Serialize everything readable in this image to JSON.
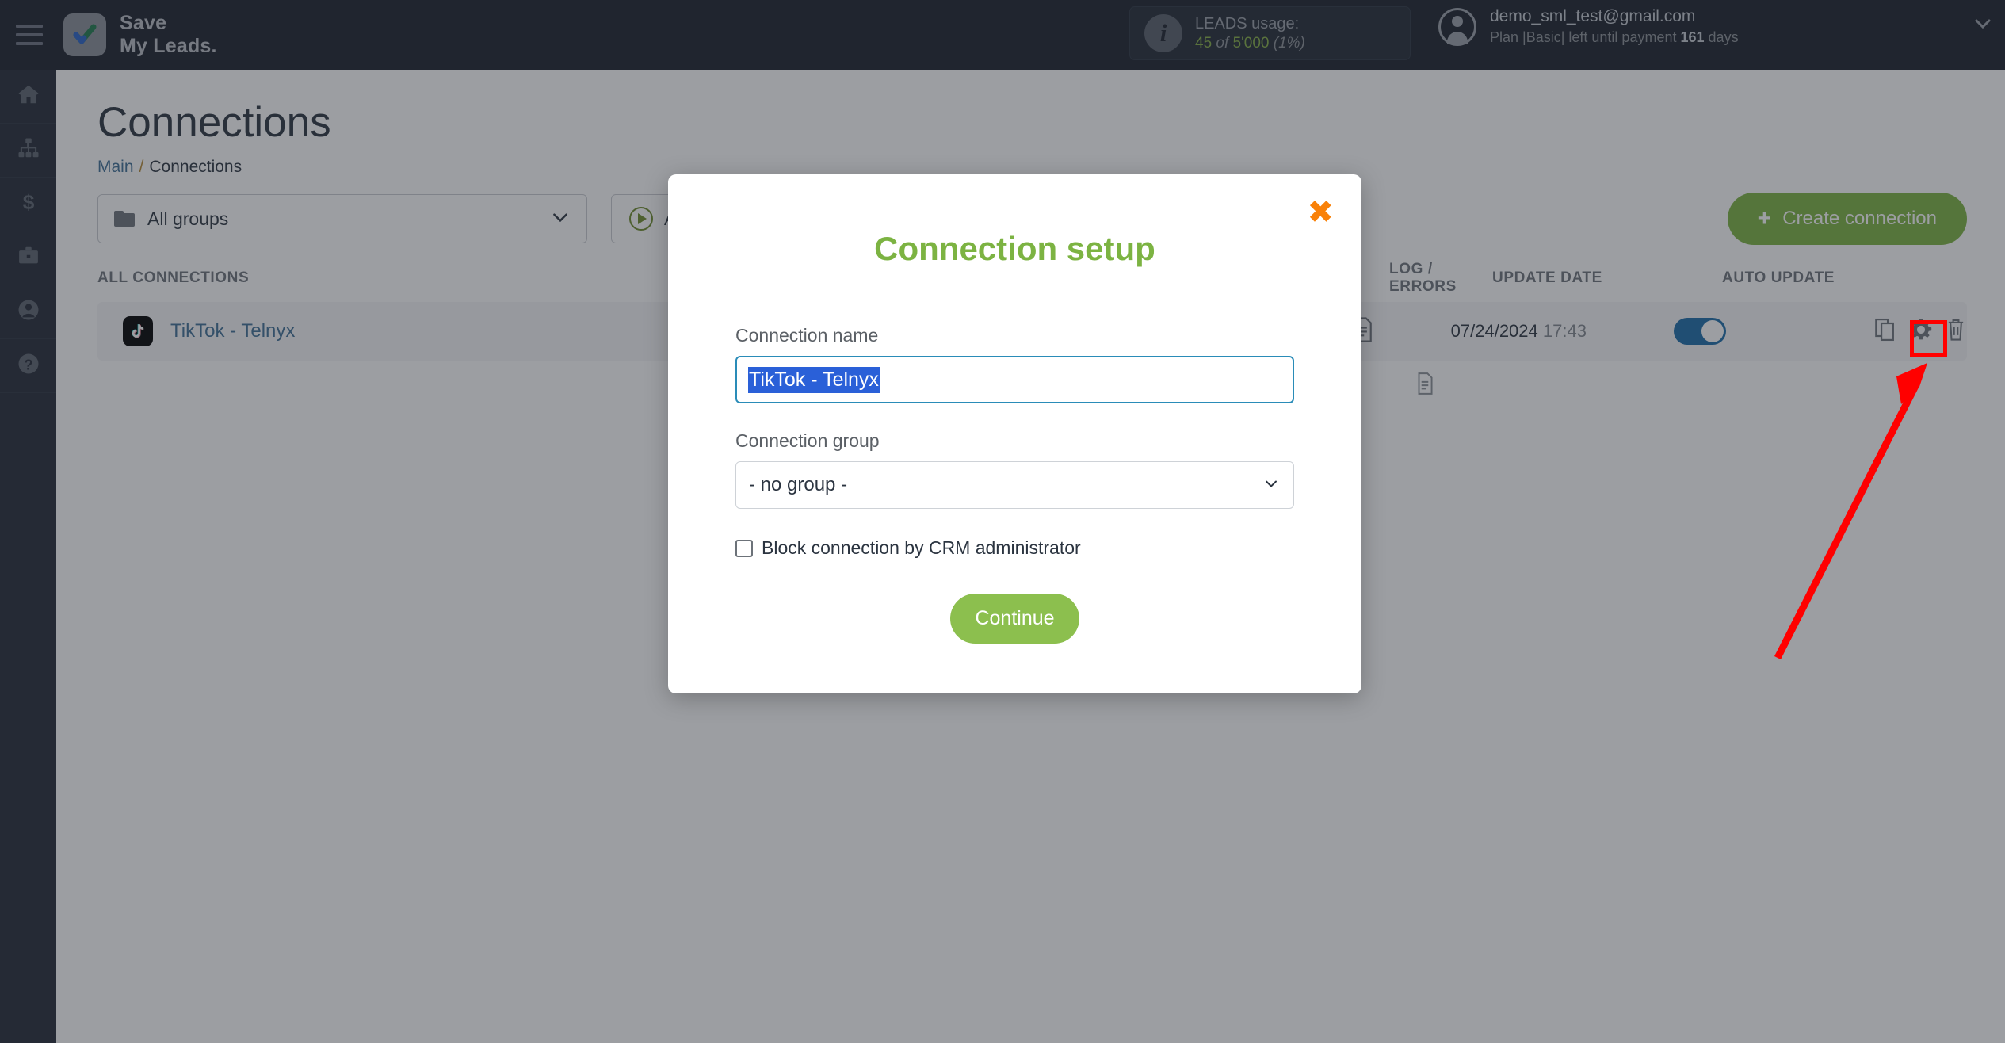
{
  "topbar": {
    "menu_icon": "hamburger-icon",
    "logo_line1": "Save",
    "logo_line2": "My Leads.",
    "leads": {
      "icon": "info-icon",
      "title": "LEADS usage:",
      "used": "45",
      "of": "of",
      "total": "5'000",
      "percent": "(1%)"
    },
    "account": {
      "avatar_icon": "user-avatar-icon",
      "email": "demo_sml_test@gmail.com",
      "plan_prefix": "Plan |Basic| left until payment",
      "plan_days": "161",
      "plan_suffix": "days",
      "chevron_icon": "chevron-down-icon"
    }
  },
  "sidebar": {
    "items": [
      {
        "name": "home",
        "icon": "home-icon"
      },
      {
        "name": "connections",
        "icon": "sitemap-icon"
      },
      {
        "name": "billing",
        "icon": "dollar-icon"
      },
      {
        "name": "business",
        "icon": "briefcase-icon"
      },
      {
        "name": "profile",
        "icon": "user-icon"
      },
      {
        "name": "help",
        "icon": "question-circle-icon"
      }
    ]
  },
  "page": {
    "title": "Connections",
    "breadcrumb": {
      "root": "Main",
      "separator": "/",
      "current": "Connections"
    },
    "toolbar": {
      "groups_filter": {
        "icon": "folder-icon",
        "value": "All groups",
        "chevron": "chevron-down-icon"
      },
      "status_filter": {
        "icon": "play-circle-icon",
        "value": "All connections"
      },
      "create_button": {
        "plus": "+",
        "label": "Create connection"
      }
    },
    "table": {
      "columns": [
        "ALL CONNECTIONS",
        "LOG / ERRORS",
        "UPDATE DATE",
        "AUTO UPDATE"
      ],
      "rows": [
        {
          "service_icon": "tiktok-icon",
          "name": "TikTok - Telnyx",
          "log_icon": "document-icon",
          "update_date": "07/24/2024",
          "update_time": "17:43",
          "auto_update": "on",
          "actions": [
            "copy-icon",
            "gear-icon",
            "trash-icon"
          ]
        }
      ],
      "second_row_icon": "document-icon"
    }
  },
  "modal": {
    "close_icon": "close-icon",
    "title": "Connection setup",
    "name_label": "Connection name",
    "name_value": "TikTok - Telnyx",
    "group_label": "Connection group",
    "group_value": "- no group -",
    "group_chevron": "chevron-down-icon",
    "checkbox_label": "Block connection by CRM administrator",
    "checkbox_checked": "false",
    "continue_label": "Continue"
  },
  "annotations": {
    "highlight_target": "gear-icon",
    "arrow_color": "#ff0000",
    "highlight_color": "#ff0000"
  }
}
